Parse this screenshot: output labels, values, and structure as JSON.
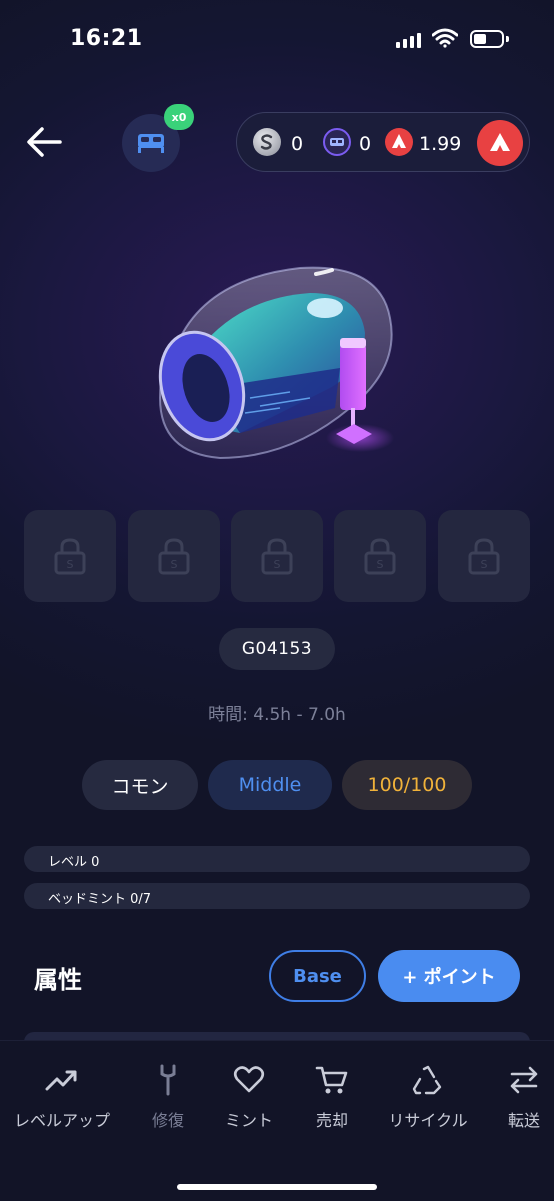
{
  "status_bar": {
    "time": "16:21"
  },
  "header": {
    "bed_badge": "x0",
    "wallet": [
      {
        "icon": "sleep-token-icon",
        "value": "0"
      },
      {
        "icon": "bed-token-icon",
        "value": "0"
      },
      {
        "icon": "avax-icon",
        "value": "1.99"
      }
    ]
  },
  "item": {
    "token_id": "G04153",
    "time_range": "時間: 4.5h - 7.0h",
    "socket_count": 5,
    "tags": {
      "rarity": "コモン",
      "class": "Middle",
      "durability": "100/100"
    },
    "level_label": "レベル 0",
    "level_progress": 0,
    "bedmint_label": "ベッドミント 0/7",
    "bedmint_progress": 0
  },
  "attributes": {
    "title": "属性",
    "base_label": "Base",
    "point_label": "+ ポイント"
  },
  "nav": [
    {
      "label": "レベルアップ",
      "icon": "trend-up-icon"
    },
    {
      "label": "修復",
      "icon": "wrench-icon"
    },
    {
      "label": "ミント",
      "icon": "heart-icon"
    },
    {
      "label": "売却",
      "icon": "cart-icon"
    },
    {
      "label": "リサイクル",
      "icon": "recycle-icon"
    },
    {
      "label": "転送",
      "icon": "transfer-icon"
    }
  ],
  "colors": {
    "accent_blue": "#4a8cf0",
    "durability_gold": "#f0b23a",
    "badge_green": "#3ad27a",
    "avax_red": "#e84142"
  }
}
